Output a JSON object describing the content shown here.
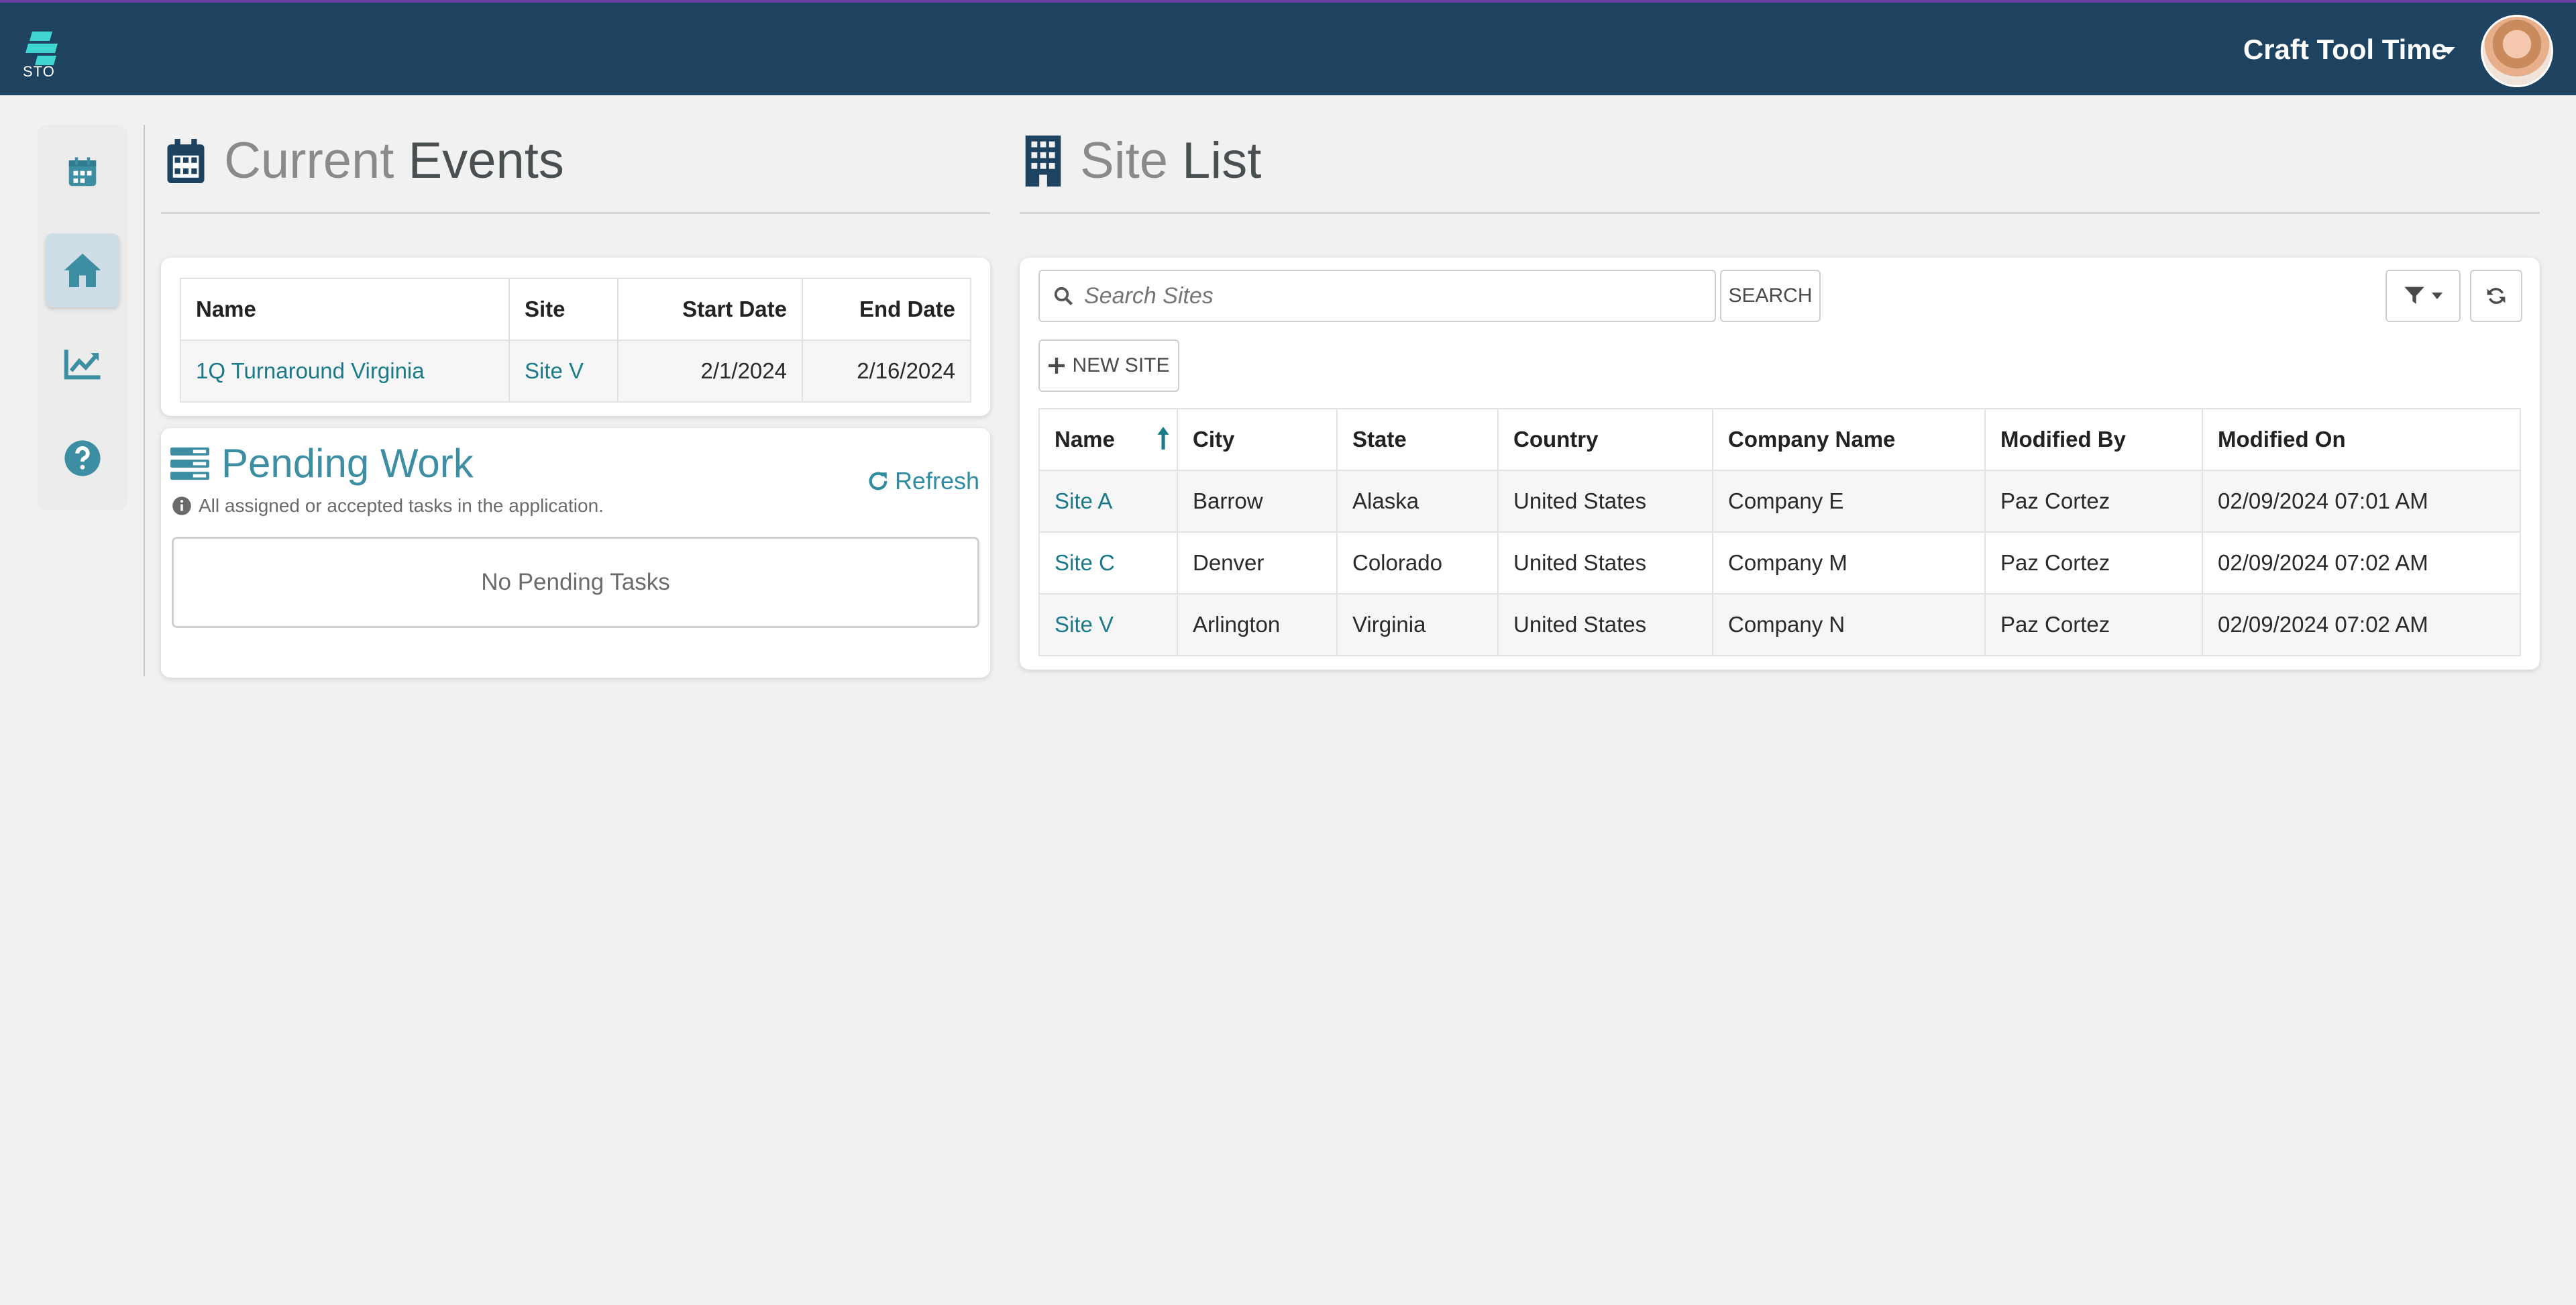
{
  "header": {
    "logo_text": "STO",
    "user_name": "Craft Tool Time"
  },
  "sidenav": {
    "items": [
      {
        "icon": "calendar-icon"
      },
      {
        "icon": "home-icon",
        "active": true
      },
      {
        "icon": "chart-line-icon"
      },
      {
        "icon": "help-icon"
      }
    ]
  },
  "current_events": {
    "title_light": "Current",
    "title_dark": "Events",
    "columns": [
      "Name",
      "Site",
      "Start Date",
      "End Date"
    ],
    "rows": [
      {
        "name": "1Q Turnaround Virginia",
        "site": "Site V",
        "start": "2/1/2024",
        "end": "2/16/2024"
      }
    ]
  },
  "pending_work": {
    "title": "Pending Work",
    "subtitle": "All assigned or accepted tasks in the application.",
    "refresh_label": "Refresh",
    "empty_text": "No Pending Tasks"
  },
  "site_list": {
    "title_light": "Site",
    "title_dark": "List",
    "search_placeholder": "Search Sites",
    "search_button": "SEARCH",
    "new_site_button": "NEW SITE",
    "columns": [
      "Name",
      "City",
      "State",
      "Country",
      "Company Name",
      "Modified By",
      "Modified On"
    ],
    "rows": [
      [
        "Site A",
        "Barrow",
        "Alaska",
        "United States",
        "Company E",
        "Paz Cortez",
        "02/09/2024 07:01 AM"
      ],
      [
        "Site C",
        "Denver",
        "Colorado",
        "United States",
        "Company M",
        "Paz Cortez",
        "02/09/2024 07:02 AM"
      ],
      [
        "Site V",
        "Arlington",
        "Virginia",
        "United States",
        "Company N",
        "Paz Cortez",
        "02/09/2024 07:02 AM"
      ]
    ]
  },
  "colors": {
    "header_bg": "#1e4360",
    "accent": "#1b7a8a",
    "nav_icon": "#3d8ea3"
  }
}
